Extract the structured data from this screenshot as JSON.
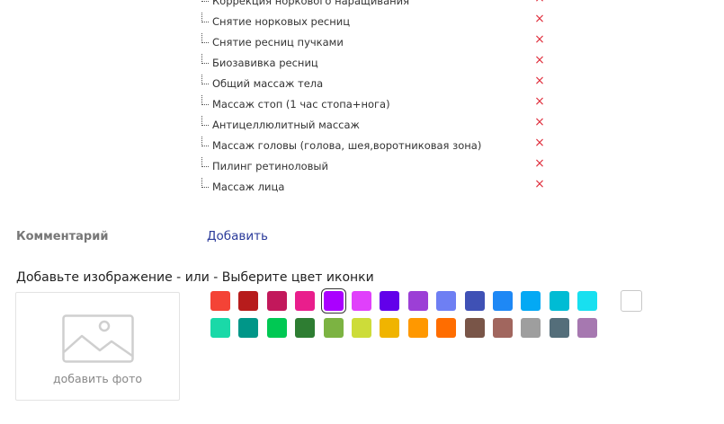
{
  "services": [
    {
      "label": "Коррекция норкового наращивания",
      "remove_icon": "×"
    },
    {
      "label": "Снятие норковых ресниц",
      "remove_icon": "×"
    },
    {
      "label": "Снятие ресниц пучками",
      "remove_icon": "×"
    },
    {
      "label": "Биозавивка ресниц",
      "remove_icon": "×"
    },
    {
      "label": "Общий массаж тела",
      "remove_icon": "×"
    },
    {
      "label": "Массаж стоп (1 час стопа+нога)",
      "remove_icon": "×"
    },
    {
      "label": "Антицеллюлитный массаж",
      "remove_icon": "×"
    },
    {
      "label": "Массаж головы (голова, шея,воротниковая зона)",
      "remove_icon": "×"
    },
    {
      "label": "Пилинг ретиноловый",
      "remove_icon": "×"
    },
    {
      "label": "Массаж лица",
      "remove_icon": "×"
    }
  ],
  "comment": {
    "label": "Комментарий",
    "add_link": "Добавить"
  },
  "image_section": {
    "heading": "Добавьте изображение - или - Выберите цвет иконки",
    "photo_label": "добавить фото",
    "photo_icon": "image-placeholder-icon"
  },
  "colors": {
    "row1": [
      "#f44336",
      "#b71c1c",
      "#c2185b",
      "#e91e8c",
      "#aa00ff",
      "#e040fb",
      "#6200ea",
      "#9c3fd6",
      "#6e7ff3",
      "#3f51b5",
      "#1e88f5",
      "#03a9f4",
      "#00bcd4",
      "#18e0f0"
    ],
    "row1_extra": "#ffffff",
    "row2": [
      "#1ad9a8",
      "#009688",
      "#00c853",
      "#2e7d32",
      "#7cb342",
      "#cddc39",
      "#f0b400",
      "#ff9800",
      "#ff6d00",
      "#795548",
      "#a1665e",
      "#9e9e9e",
      "#546e7a",
      "#a678b0"
    ],
    "selected": "#aa00ff",
    "remove_color": "#e0313f",
    "link_color": "#2a3a9a"
  }
}
